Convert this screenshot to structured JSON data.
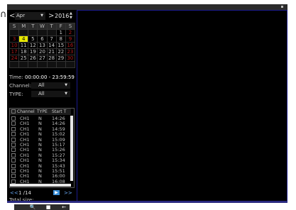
{
  "side": {
    "glyph": "∩"
  },
  "calendar": {
    "prev": "<",
    "month": "Apr",
    "next": ">",
    "year": "2016",
    "weekdays": [
      "S",
      "M",
      "T",
      "W",
      "T",
      "F",
      "S"
    ],
    "weeks": [
      [
        "",
        "",
        "",
        "",
        "",
        "1",
        "2"
      ],
      [
        "3",
        "4",
        "5",
        "6",
        "7",
        "8",
        "9"
      ],
      [
        "10",
        "11",
        "12",
        "13",
        "14",
        "15",
        "16"
      ],
      [
        "17",
        "18",
        "19",
        "20",
        "21",
        "22",
        "23"
      ],
      [
        "24",
        "25",
        "26",
        "27",
        "28",
        "29",
        "30"
      ],
      [
        "",
        "",
        "",
        "",
        "",
        "",
        ""
      ]
    ],
    "selected_day": "4",
    "highlight_color": "#e8e800",
    "weekend_color": "#b21c1c"
  },
  "filters": {
    "time_label": "Time:",
    "time_value": "00:00:00 - 23:59:59",
    "channel_label": "Channel:",
    "channel_value": "All",
    "type_label": "TYPE:",
    "type_value": "All"
  },
  "records": {
    "columns": [
      "Channel",
      "TYPE",
      "Start T"
    ],
    "rows": [
      {
        "channel": "CH1",
        "type": "N",
        "start": "14:26"
      },
      {
        "channel": "CH1",
        "type": "N",
        "start": "14:26"
      },
      {
        "channel": "CH1",
        "type": "N",
        "start": "14:59"
      },
      {
        "channel": "CH1",
        "type": "N",
        "start": "15:02"
      },
      {
        "channel": "CH1",
        "type": "N",
        "start": "15:09"
      },
      {
        "channel": "CH1",
        "type": "N",
        "start": "15:17"
      },
      {
        "channel": "CH1",
        "type": "N",
        "start": "15:26"
      },
      {
        "channel": "CH1",
        "type": "N",
        "start": "15:27"
      },
      {
        "channel": "CH1",
        "type": "N",
        "start": "15:34"
      },
      {
        "channel": "CH1",
        "type": "N",
        "start": "15:43"
      },
      {
        "channel": "CH1",
        "type": "N",
        "start": "15:51"
      },
      {
        "channel": "CH1",
        "type": "N",
        "start": "16:00"
      },
      {
        "channel": "CH1",
        "type": "N",
        "start": "16:08"
      }
    ]
  },
  "pager": {
    "prev": "<<",
    "page": "1 /14",
    "next": ">>"
  },
  "footer": {
    "total_label": "Total size:",
    "buttons": [
      {
        "icon": "search-icon",
        "glyph": "🔍"
      },
      {
        "icon": "save-icon",
        "glyph": "■"
      },
      {
        "icon": "back-icon",
        "glyph": "←"
      }
    ]
  },
  "colors": {
    "accent": "#3a8fd9",
    "viewer_border": "#1a1a8c"
  }
}
